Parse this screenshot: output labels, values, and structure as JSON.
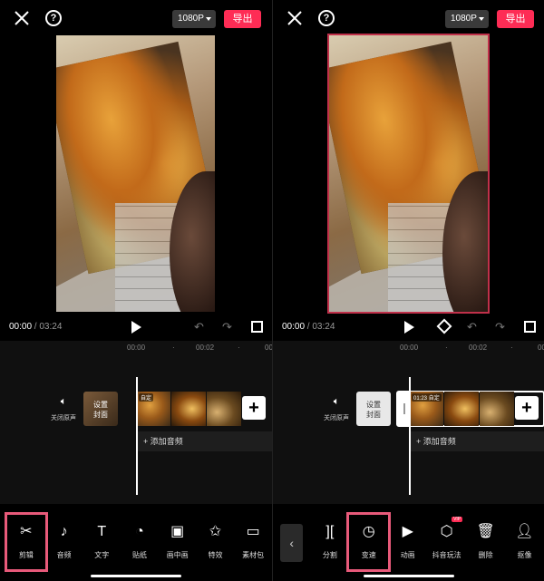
{
  "left": {
    "topbar": {
      "resolution": "1080P",
      "export_label": "导出"
    },
    "playback": {
      "current_time": "00:00",
      "separator": " / ",
      "total_time": "03:24"
    },
    "ruler": {
      "t0": "00:00",
      "t1": "00:02",
      "t2": "00"
    },
    "timeline": {
      "mute_label": "关闭原声",
      "cover_label_line1": "设置",
      "cover_label_line2": "封面",
      "clip_badge": "自定",
      "add_audio_label": "+ 添加音频"
    },
    "toolbar": [
      {
        "icon": "scissors-icon",
        "label": "剪辑",
        "active": true
      },
      {
        "icon": "music-icon",
        "label": "音频",
        "active": false
      },
      {
        "icon": "text-icon",
        "label": "文字",
        "active": false
      },
      {
        "icon": "sticker-icon",
        "label": "贴纸",
        "active": false
      },
      {
        "icon": "pip-icon",
        "label": "画中画",
        "active": false
      },
      {
        "icon": "effects-icon",
        "label": "特效",
        "active": false
      },
      {
        "icon": "material-icon",
        "label": "素材包",
        "active": false
      }
    ]
  },
  "right": {
    "topbar": {
      "resolution": "1080P",
      "export_label": "导出"
    },
    "playback": {
      "current_time": "00:00",
      "separator": " / ",
      "total_time": "03:24"
    },
    "ruler": {
      "t0": "00:00",
      "t1": "00:02",
      "t2": "00"
    },
    "timeline": {
      "mute_label": "关闭原声",
      "cover_label_line1": "设置",
      "cover_label_line2": "封面",
      "clip_duration": "01:23",
      "clip_badge": "自定",
      "add_audio_label": "+ 添加音频"
    },
    "toolbar": [
      {
        "icon": "split-icon",
        "label": "分割",
        "active": false
      },
      {
        "icon": "speed-icon",
        "label": "变速",
        "active": true
      },
      {
        "icon": "animation-icon",
        "label": "动画",
        "active": false
      },
      {
        "icon": "douyin-effects-icon",
        "label": "抖音玩法",
        "active": false,
        "badge": "VIP"
      },
      {
        "icon": "delete-icon",
        "label": "删除",
        "active": false
      },
      {
        "icon": "cutout-icon",
        "label": "抠像",
        "active": false
      }
    ]
  }
}
